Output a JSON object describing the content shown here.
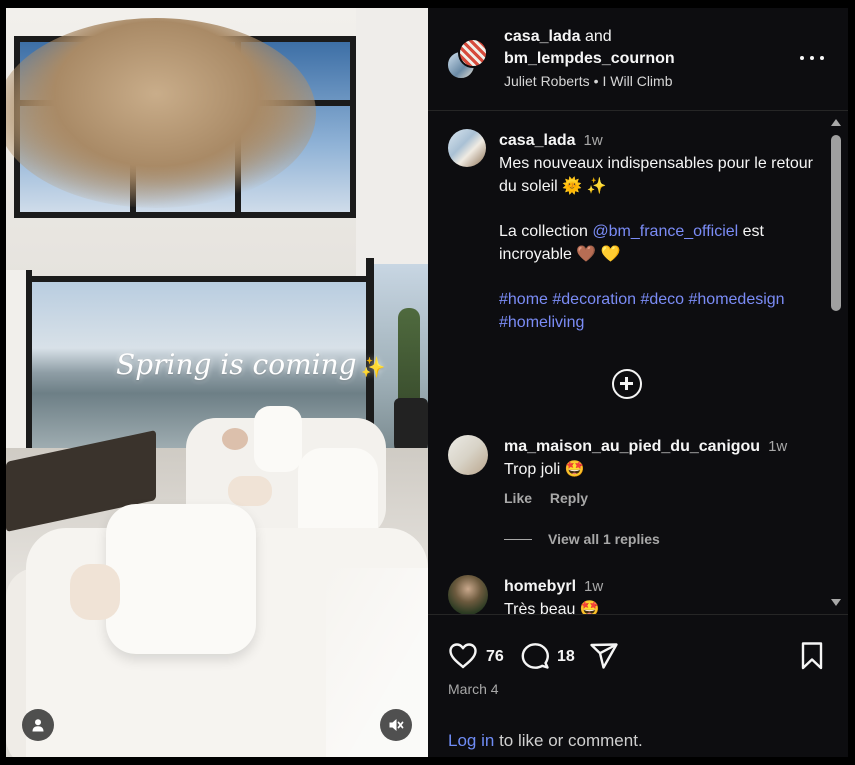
{
  "media": {
    "overlay_text": "Spring is coming",
    "overlay_emoji": "✨"
  },
  "header": {
    "user1": "casa_lada",
    "joiner": "and",
    "user2": "bm_lempdes_cournon",
    "audio_artist": "Juliet Roberts",
    "audio_separator": "•",
    "audio_title": "I Will Climb"
  },
  "caption": {
    "username": "casa_lada",
    "time": "1w",
    "line1": "Mes nouveaux indispensables pour le retour du soleil",
    "line1_emojis": "🌞 ✨",
    "line2_prefix": "La collection",
    "mention": "@bm_france_officiel",
    "line2_suffix": "est incroyable",
    "line2_emojis_a": "🤎",
    "line2_emojis_b": "💛",
    "hashtags": [
      "#home",
      "#decoration",
      "#deco",
      "#homedesign",
      "#homeliving"
    ]
  },
  "comments": [
    {
      "username": "ma_maison_au_pied_du_canigou",
      "time": "1w",
      "text": "Trop joli",
      "emoji": "🤩",
      "like_label": "Like",
      "reply_label": "Reply"
    },
    {
      "username": "homebyrl",
      "time": "1w",
      "text": "Très beau",
      "emoji": "🤩"
    }
  ],
  "view_replies": "View all 1 replies",
  "stats": {
    "likes": "76",
    "comments": "18",
    "date": "March 4"
  },
  "login": {
    "link": "Log in",
    "rest": "to like or comment."
  }
}
